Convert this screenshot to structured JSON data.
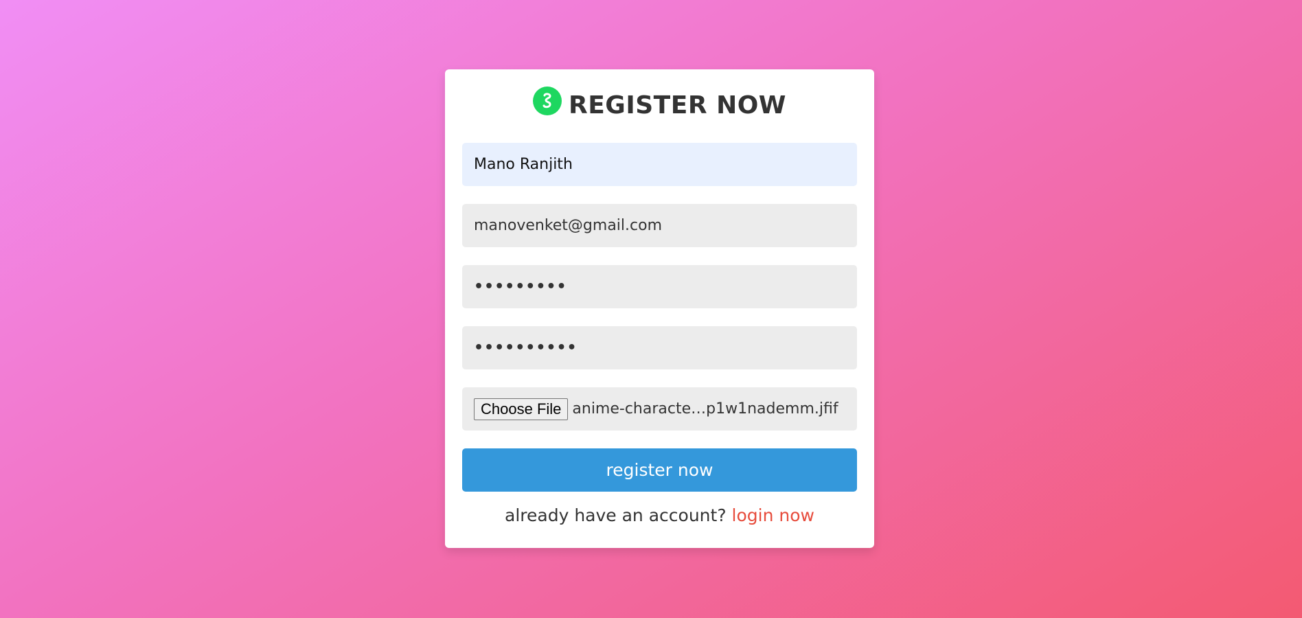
{
  "colors": {
    "card_background": "#ffffff",
    "title_text": "#333333",
    "logo": "#1ed760",
    "autofill_field": "#e8f0fe",
    "field_background": "#ececec",
    "submit_button": "#3498db",
    "login_link": "#e74c3c"
  },
  "form": {
    "logo_icon": "link-icon",
    "title": "REGISTER NOW",
    "name_value": "Mano Ranjith",
    "email_value": "manovenket@gmail.com",
    "password_value": "•••••••••",
    "confirm_password_value": "••••••••••",
    "file_button_label": "Choose File",
    "file_name": "anime-characte…p1w1nademm.jfif",
    "submit_label": "register now",
    "footer_text": "already have an account?",
    "login_link_label": "login now"
  }
}
